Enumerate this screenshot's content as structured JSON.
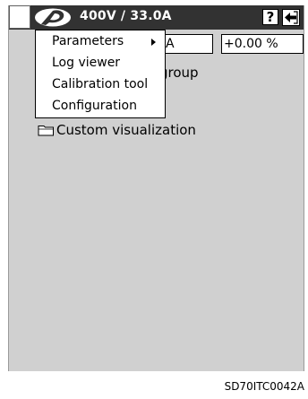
{
  "titlebar": {
    "title": "400V / 33.0A",
    "help_label": "?"
  },
  "fields": {
    "left_value": "A",
    "right_value": "+0.00 %"
  },
  "tree": {
    "items": [
      {
        "label": "group"
      },
      {
        "label": "Custom visualization"
      }
    ]
  },
  "menu": {
    "items": [
      {
        "label": "Parameters"
      },
      {
        "label": "Log viewer"
      },
      {
        "label": "Calibration tool"
      },
      {
        "label": "Configuration"
      }
    ]
  },
  "caption": "SD70ITC0042A",
  "colors": {
    "titlebar": "#323232",
    "screen_bg": "#d0d0d0",
    "menu_bg": "#ffffff"
  },
  "icons": {
    "logo": "brand-logo-icon",
    "help": "help-icon",
    "back": "back-arrow-icon",
    "folder": "folder-icon",
    "submenu": "submenu-arrow-icon"
  }
}
